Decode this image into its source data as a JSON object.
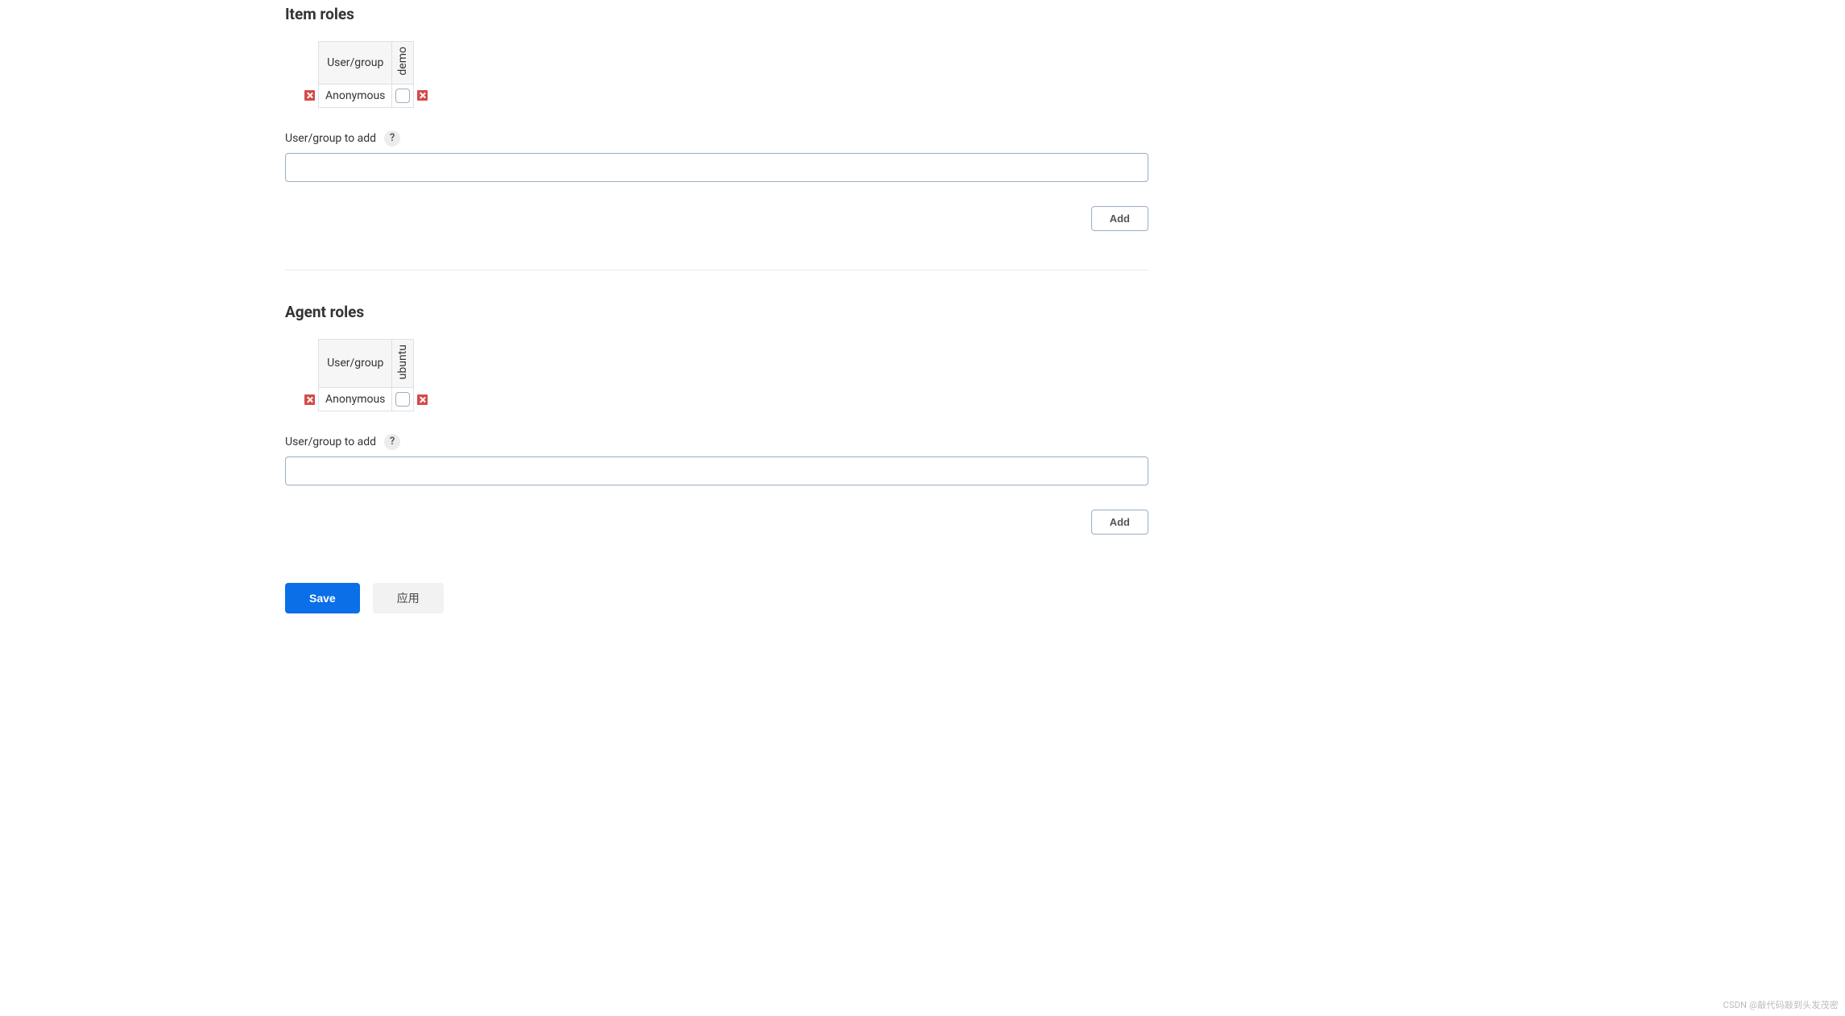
{
  "sections": {
    "item": {
      "title": "Item roles",
      "table": {
        "ug_header": "User/group",
        "columns": [
          "demo"
        ],
        "rows": [
          {
            "name": "Anonymous",
            "checks": [
              false
            ]
          }
        ]
      },
      "add_label": "User/group to add",
      "input_value": "",
      "add_button": "Add"
    },
    "agent": {
      "title": "Agent roles",
      "table": {
        "ug_header": "User/group",
        "columns": [
          "ubuntu"
        ],
        "rows": [
          {
            "name": "Anonymous",
            "checks": [
              false
            ]
          }
        ]
      },
      "add_label": "User/group to add",
      "input_value": "",
      "add_button": "Add"
    }
  },
  "help_glyph": "?",
  "buttons": {
    "save": "Save",
    "apply": "应用"
  },
  "watermark": "CSDN @敲代码敲到头发茂密"
}
